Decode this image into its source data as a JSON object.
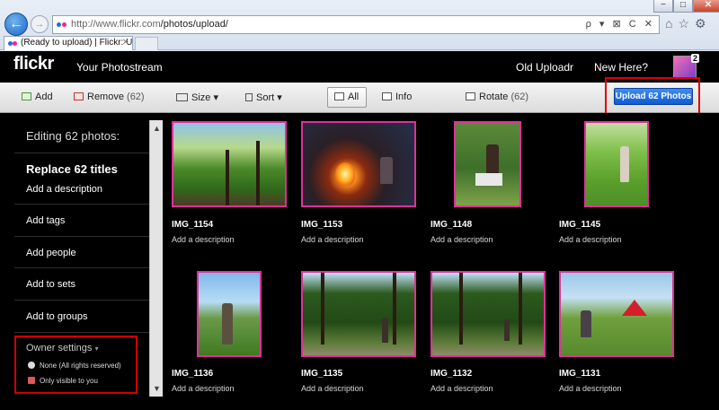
{
  "browser": {
    "url_host": "http://www.flickr.com",
    "url_path": "/photos/upload/",
    "tab_title": "(Ready to upload) | Flickr: U...",
    "address_tools": "ρ ▾ ⊠ C ✕",
    "window_controls": {
      "minimize": "−",
      "maximize": "□",
      "close": "✕"
    },
    "icons": [
      "home-icon",
      "star-icon",
      "gear-icon"
    ]
  },
  "header": {
    "logo": "flickr",
    "your_photostream": "Your Photostream",
    "old_uploadr": "Old Uploadr",
    "new_here": "New Here?",
    "buddy_badge": "2"
  },
  "toolbar": {
    "add": "Add",
    "remove": "Remove",
    "remove_count": "(62)",
    "size": "Size",
    "sort": "Sort",
    "all": "All",
    "info": "Info",
    "rotate": "Rotate",
    "rotate_count": "(62)",
    "upload": "Upload 62 Photos"
  },
  "panel": {
    "editing": "Editing 62 photos:",
    "replace_titles": "Replace 62 titles",
    "add_description": "Add a description",
    "add_tags": "Add tags",
    "add_people": "Add people",
    "add_to_sets": "Add to sets",
    "add_to_groups": "Add to groups",
    "owner_settings": "Owner settings",
    "license": "None (All rights reserved)",
    "visibility": "Only visible to you"
  },
  "photos": [
    {
      "name": "IMG_1154",
      "desc": "Add a description"
    },
    {
      "name": "IMG_1153",
      "desc": "Add a description"
    },
    {
      "name": "IMG_1148",
      "desc": "Add a description"
    },
    {
      "name": "IMG_1145",
      "desc": "Add a description"
    },
    {
      "name": "IMG_1136",
      "desc": "Add a description"
    },
    {
      "name": "IMG_1135",
      "desc": "Add a description"
    },
    {
      "name": "IMG_1132",
      "desc": "Add a description"
    },
    {
      "name": "IMG_1131",
      "desc": "Add a description"
    }
  ],
  "colors": {
    "highlight_border": "#e00000",
    "thumb_border": "#e0309a",
    "upload_button": "#1f6fe0"
  }
}
